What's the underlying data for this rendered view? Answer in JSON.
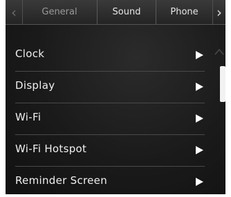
{
  "tabs": {
    "general": "General",
    "sound": "Sound",
    "phone": "Phone",
    "prev_icon": "chevron-left-icon",
    "next_icon": "chevron-right-icon"
  },
  "menu": {
    "items": [
      {
        "label": "Clock"
      },
      {
        "label": "Display"
      },
      {
        "label": "Wi-Fi"
      },
      {
        "label": "Wi-Fi Hotspot"
      },
      {
        "label": "Reminder Screen"
      }
    ]
  },
  "scroll": {
    "up_icon": "chevron-up-icon"
  },
  "colors": {
    "background": "#1a1a1a",
    "text": "#f0f0f0",
    "active_tab_text": "#9a9a9a",
    "divider": "#4a4a4a"
  }
}
